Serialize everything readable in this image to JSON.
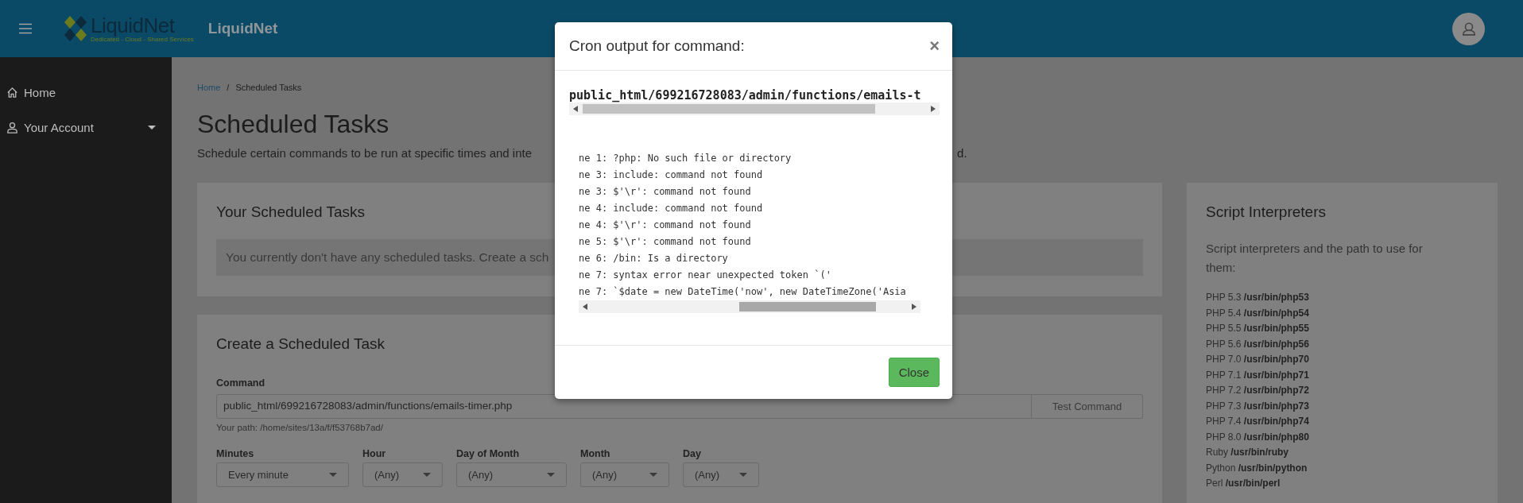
{
  "header": {
    "logo": {
      "name": "LiquidNet",
      "tagline": "Dedicated - Cloud - Shared Services"
    },
    "brand": "LiquidNet"
  },
  "sidebar": {
    "items": [
      {
        "label": "Home",
        "kind": "home",
        "expandable": false
      },
      {
        "label": "Your Account",
        "kind": "account",
        "expandable": true
      }
    ]
  },
  "breadcrumb": [
    {
      "label": "Home",
      "kind": "link"
    },
    {
      "label": "/",
      "kind": "separator"
    },
    {
      "label": "Scheduled Tasks",
      "kind": "current"
    }
  ],
  "page": {
    "title": "Scheduled Tasks",
    "description_start": "Schedule certain commands to be run at specific times and inte",
    "description_end": "d."
  },
  "tasks_card": {
    "title": "Your Scheduled Tasks",
    "notice": "You currently don't have any scheduled tasks. Create a sch"
  },
  "create_card": {
    "title": "Create a Scheduled Task",
    "command_label": "Command",
    "command_value": "public_html/699216728083/admin/functions/emails-timer.php",
    "test_button": "Test Command",
    "path_hint": "Your path: /home/sites/13a/f/f53768b7ad/",
    "schedule": [
      {
        "label": "Minutes",
        "value": "Every minute"
      },
      {
        "label": "Hour",
        "value": "(Any)"
      },
      {
        "label": "Day of Month",
        "value": "(Any)"
      },
      {
        "label": "Month",
        "value": "(Any)"
      },
      {
        "label": "Day",
        "value": "(Any)"
      }
    ]
  },
  "interpreters_card": {
    "title": "Script Interpreters",
    "intro": "Script interpreters and the path to use for them:",
    "items": [
      "PHP 5.3 **/usr/bin/php53**",
      "PHP 5.4 **/usr/bin/php54**",
      "PHP 5.5 **/usr/bin/php55**",
      "PHP 5.6 **/usr/bin/php56**",
      "PHP 7.0 **/usr/bin/php70**",
      "PHP 7.1 **/usr/bin/php71**",
      "PHP 7.2 **/usr/bin/php72**",
      "PHP 7.3 **/usr/bin/php73**",
      "PHP 7.4 **/usr/bin/php74**",
      "PHP 8.0 **/usr/bin/php80**",
      "Ruby **/usr/bin/ruby**",
      "Python **/usr/bin/python**",
      "Perl **/usr/bin/perl**"
    ]
  },
  "modal": {
    "title": "Cron output for command:",
    "close_symbol": "×",
    "command": "public_html/699216728083/admin/functions/emails-t",
    "output_lines": [
      "ne 1: ?php: No such file or directory",
      "ne 3: include: command not found",
      "ne 3: $'\\r': command not found",
      "ne 4: include: command not found",
      "ne 4: $'\\r': command not found",
      "ne 5: $'\\r': command not found",
      "ne 6: /bin: Is a directory",
      "ne 7: syntax error near unexpected token `('",
      "ne 7: `$date = new DateTime('now', new DateTimeZone('Asia"
    ],
    "close_button": "Close"
  }
}
